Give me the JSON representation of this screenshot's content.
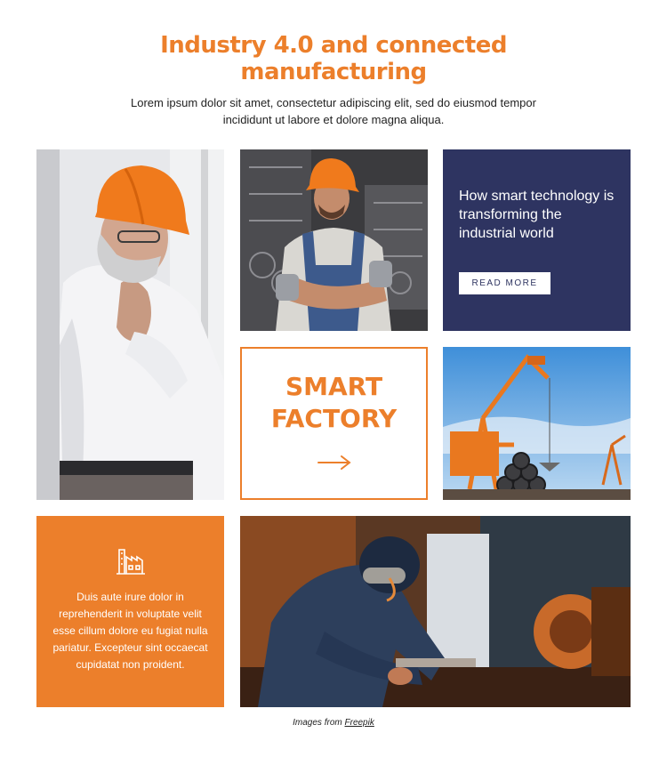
{
  "header": {
    "title_line1": "Industry 4.0 and connected",
    "title_line2": "manufacturing",
    "subtitle": "Lorem ipsum dolor sit amet, consectetur adipiscing elit, sed do eiusmod tempor incididunt ut labore et dolore magna aliqua."
  },
  "feature_card": {
    "heading": "How smart technology is transforming the industrial world",
    "button_label": "READ MORE"
  },
  "smart_card": {
    "line1": "SMART",
    "line2": "FACTORY",
    "arrow_icon": "arrow-right-icon"
  },
  "info_card": {
    "icon": "factory-icon",
    "text": "Duis aute irure dolor in reprehenderit in voluptate velit esse cillum dolore eu fugiat nulla pariatur. Excepteur sint occaecat cupidatat non proident."
  },
  "credit": {
    "prefix": "Images from",
    "link_label": "Freepik"
  },
  "colors": {
    "accent": "#ec7f2b",
    "navy": "#2e3461",
    "background": "#ffffff"
  }
}
